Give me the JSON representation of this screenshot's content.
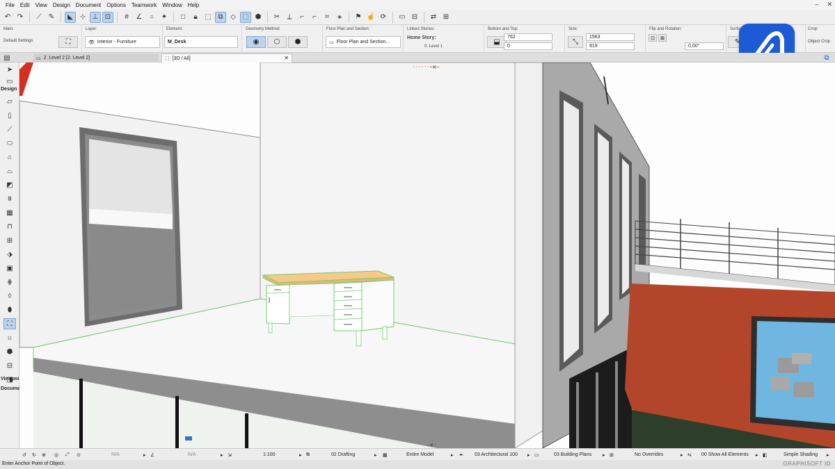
{
  "menu": [
    "File",
    "Edit",
    "View",
    "Design",
    "Document",
    "Options",
    "Teamwork",
    "Window",
    "Help"
  ],
  "infobox": {
    "main_label": "Main:",
    "main_value": "Default Settings",
    "layer_label": "Layer:",
    "layer_value": "Interior - Furniture",
    "element_label": "Element:",
    "element_value": "M_Desk",
    "geometry_label": "Geometry Method:",
    "floorplan_label": "Floor Plan and Section:",
    "floorplan_value": "Floor Plan and Section...",
    "linked_label": "Linked Stories:",
    "home_story_label": "Home Story:",
    "home_story_value": "0. Level 1",
    "bottomtop_label": "Bottom and Top:",
    "top_value": "762",
    "bottom_value": "0",
    "size_label": "Size:",
    "size_a": "1563",
    "size_b": "819",
    "flip_label": "Flip and Rotation:",
    "rotation_value": "0,00°",
    "surface_label": "Surface:",
    "crop_label": "Crop:",
    "crop_value": "Object Crop"
  },
  "tabs": {
    "tab1": "2. Level 2 [2. Level 2]",
    "tab2": "[3D / All]"
  },
  "toolbox": {
    "design_label": "Design",
    "viewpoint_label": "Viewpoi",
    "document_label": "Docume"
  },
  "bottombar": {
    "na1": "N/A",
    "na2": "N/A",
    "scale": "1:100",
    "layer_combo": "02 Drafting",
    "model_view": "Entire Model",
    "pen_set": "03 Architectural 100",
    "graphic_override": "03 Building Plans",
    "renovation": "No Overrides",
    "filter": "00 Show All Elements",
    "shading": "Simple Shading"
  },
  "status": {
    "message": "Enter Anchor Point of Object.",
    "brand": "GRAPHISOFT ID"
  },
  "colors": {
    "accent": "#1c5ad6",
    "selection": "#7fd07f",
    "desk_top": "#f4c98a",
    "facade": "#b3462a"
  }
}
